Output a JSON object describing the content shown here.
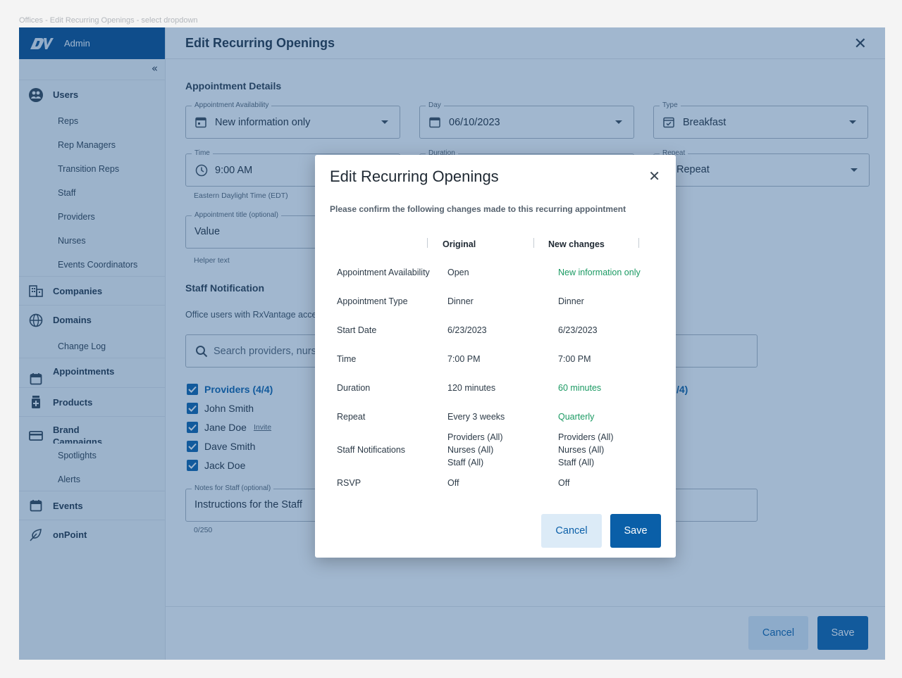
{
  "frame_label": "Offices - Edit Recurring Openings - select dropdown",
  "sidebar": {
    "brand_text": "Admin",
    "groups": [
      {
        "label": "Users",
        "icon": "users-icon"
      },
      {
        "label": "Companies",
        "icon": "building-icon"
      },
      {
        "label": "Domains",
        "icon": "globe-icon"
      },
      {
        "label": "Appointments",
        "icon": "calendar-icon"
      },
      {
        "label": "Products",
        "icon": "product-icon"
      },
      {
        "label": "Brand Campaigns",
        "icon": "card-icon"
      },
      {
        "label": "Events",
        "icon": "calendar-icon"
      },
      {
        "label": "onPoint",
        "icon": "leaf-icon"
      }
    ],
    "user_subitems": [
      "Reps",
      "Rep Managers",
      "Transition Reps",
      "Staff",
      "Providers",
      "Nurses",
      "Events Coordinators"
    ],
    "domain_subitems": [
      "Change Log"
    ],
    "brand_subitems": [
      "Spotlights",
      "Alerts"
    ]
  },
  "page": {
    "title": "Edit Recurring Openings",
    "appointment_details_title": "Appointment Details",
    "availability": {
      "label": "Appointment Availability",
      "value": "New information only"
    },
    "day": {
      "label": "Day",
      "value": "06/10/2023"
    },
    "type": {
      "label": "Type",
      "value": "Breakfast"
    },
    "time": {
      "label": "Time",
      "value": "9:00 AM"
    },
    "duration": {
      "label": "Duration"
    },
    "repeat": {
      "label": "Repeat",
      "value": "Repeat"
    },
    "timezone_helper": "Eastern Daylight Time (EDT)",
    "appt_title": {
      "label": "Appointment title (optional)",
      "value": "Value"
    },
    "appt_title_helper": "Helper text",
    "staff_notification_title": "Staff Notification",
    "staff_notification_text": "Office users with RxVantage access",
    "search_placeholder": "Search providers, nurses",
    "providers_head": "Providers (4/4)",
    "right_head_partial": "/4)",
    "providers": [
      "John Smith",
      "Jane Doe",
      "Dave Smith",
      "Jack Doe"
    ],
    "invite_label": "Invite",
    "notes": {
      "label": "Notes for Staff (optional)",
      "value": "Instructions for the Staff"
    },
    "notes_counter": "0/250",
    "cancel_label": "Cancel",
    "save_label": "Save"
  },
  "dialog": {
    "title": "Edit Recurring Openings",
    "subtitle": "Please confirm the following changes made to this recurring appointment",
    "col_original": "Original",
    "col_new": "New changes",
    "rows": [
      {
        "label": "Appointment Availability",
        "original": "Open",
        "new": "New information only",
        "changed": true
      },
      {
        "label": "Appointment Type",
        "original": "Dinner",
        "new": "Dinner",
        "changed": false
      },
      {
        "label": "Start Date",
        "original": "6/23/2023",
        "new": "6/23/2023",
        "changed": false
      },
      {
        "label": "Time",
        "original": "7:00 PM",
        "new": "7:00 PM",
        "changed": false
      },
      {
        "label": "Duration",
        "original": "120 minutes",
        "new": "60 minutes",
        "changed": true
      },
      {
        "label": "Repeat",
        "original": "Every 3 weeks",
        "new": "Quarterly",
        "changed": true
      },
      {
        "label": "Staff Notifications",
        "original": [
          "Providers (All)",
          "Nurses (All)",
          "Staff (All)"
        ],
        "new": [
          "Providers (All)",
          "Nurses (All)",
          "Staff (All)"
        ],
        "changed": false
      },
      {
        "label": "RSVP",
        "original": "Off",
        "new": "Off",
        "changed": false
      }
    ],
    "cancel_label": "Cancel",
    "save_label": "Save"
  },
  "colors": {
    "brand": "#05498a",
    "primary": "#0a5fa8",
    "secondary_bg": "#dcebf7",
    "changed": "#1b9a63",
    "overlay": "rgba(32,84,140,0.42)"
  }
}
